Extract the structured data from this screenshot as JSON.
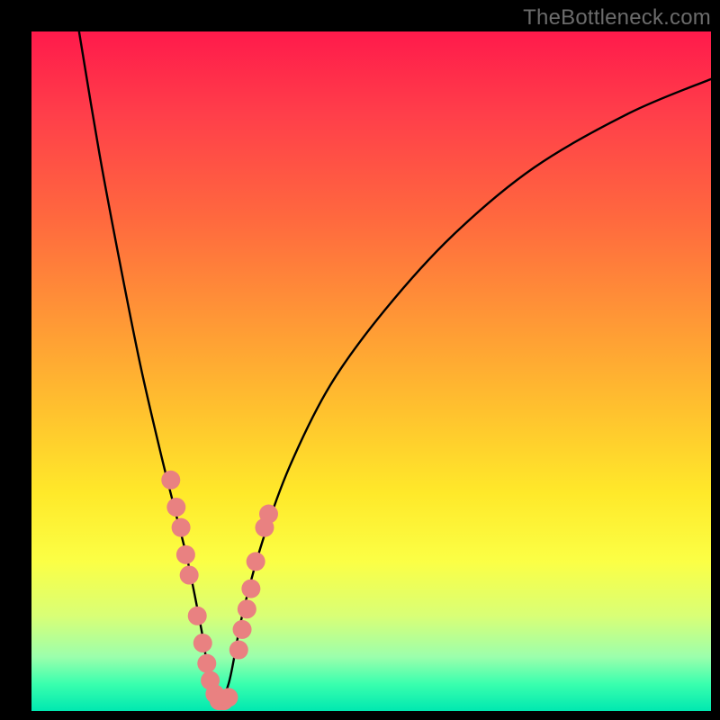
{
  "watermark": "TheBottleneck.com",
  "colors": {
    "curve": "#000000",
    "marker_fill": "#e98181",
    "marker_stroke": "#945c5c"
  },
  "chart_data": {
    "type": "line",
    "title": "",
    "xlabel": "",
    "ylabel": "",
    "xlim": [
      0,
      100
    ],
    "ylim": [
      0,
      100
    ],
    "grid": false,
    "legend": false,
    "series": [
      {
        "name": "curve",
        "comment": "V-shaped curve; y roughly percentage bottleneck, x normalized 0-100 across plot width. Minimum ~0 near x≈27.",
        "x": [
          7,
          10,
          13,
          16,
          19,
          21,
          23,
          25,
          27,
          29,
          31,
          34,
          38,
          44,
          52,
          62,
          74,
          88,
          100
        ],
        "y": [
          100,
          82,
          66,
          51,
          38,
          30,
          22,
          12,
          1,
          4,
          14,
          25,
          36,
          48,
          59,
          70,
          80,
          88,
          93
        ]
      }
    ],
    "markers": {
      "comment": "Salmon bead markers drawn along the curve near the valley. Values share the same x/y scale as the curve series.",
      "points": [
        {
          "x": 20.5,
          "y": 34
        },
        {
          "x": 21.3,
          "y": 30
        },
        {
          "x": 22.0,
          "y": 27
        },
        {
          "x": 22.7,
          "y": 23
        },
        {
          "x": 23.2,
          "y": 20
        },
        {
          "x": 24.4,
          "y": 14
        },
        {
          "x": 25.2,
          "y": 10
        },
        {
          "x": 25.8,
          "y": 7
        },
        {
          "x": 26.3,
          "y": 4.5
        },
        {
          "x": 27.0,
          "y": 2.5
        },
        {
          "x": 27.6,
          "y": 1.5
        },
        {
          "x": 28.3,
          "y": 1.5
        },
        {
          "x": 29.0,
          "y": 2.0
        },
        {
          "x": 30.5,
          "y": 9
        },
        {
          "x": 31.0,
          "y": 12
        },
        {
          "x": 31.7,
          "y": 15
        },
        {
          "x": 32.3,
          "y": 18
        },
        {
          "x": 33.0,
          "y": 22
        },
        {
          "x": 34.3,
          "y": 27
        },
        {
          "x": 34.9,
          "y": 29
        }
      ]
    }
  }
}
